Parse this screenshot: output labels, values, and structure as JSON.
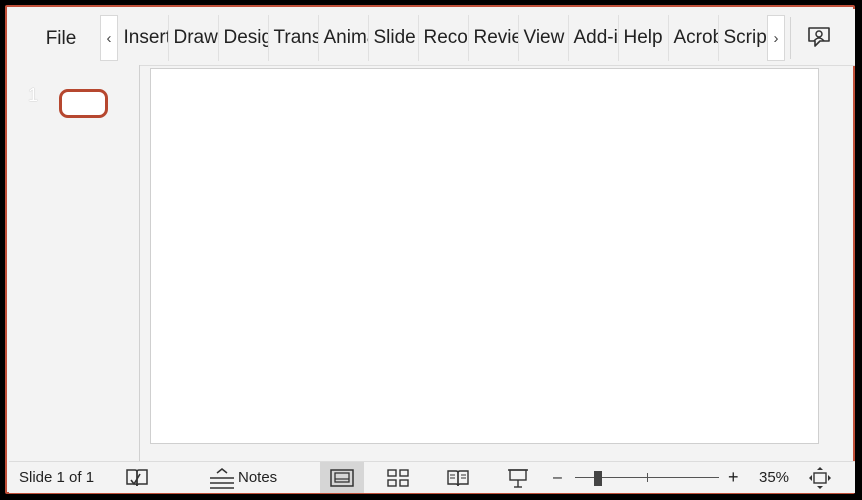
{
  "ribbon": {
    "file_label": "File",
    "scroll_left": "‹",
    "scroll_right": "›",
    "tabs": [
      {
        "label": "Insert"
      },
      {
        "label": "Draw"
      },
      {
        "label": "Design"
      },
      {
        "label": "Transitions"
      },
      {
        "label": "Animations"
      },
      {
        "label": "Slide Show"
      },
      {
        "label": "Record"
      },
      {
        "label": "Review"
      },
      {
        "label": "View"
      },
      {
        "label": "Add-ins"
      },
      {
        "label": "Help"
      },
      {
        "label": "Acrobat"
      },
      {
        "label": "Script Lab"
      }
    ],
    "coauthor_icon": "comments-person-icon"
  },
  "thumbnails": {
    "slide_number": "1"
  },
  "status_bar": {
    "slide_info": "Slide 1 of 1",
    "notes_label": "Notes",
    "zoom_minus": "–",
    "zoom_plus": "+",
    "zoom_value": "35%",
    "zoom_level": 0.35
  },
  "colors": {
    "accent": "#c0503a",
    "thumbnail_border": "#b6472f",
    "background": "#f3f3f3"
  }
}
